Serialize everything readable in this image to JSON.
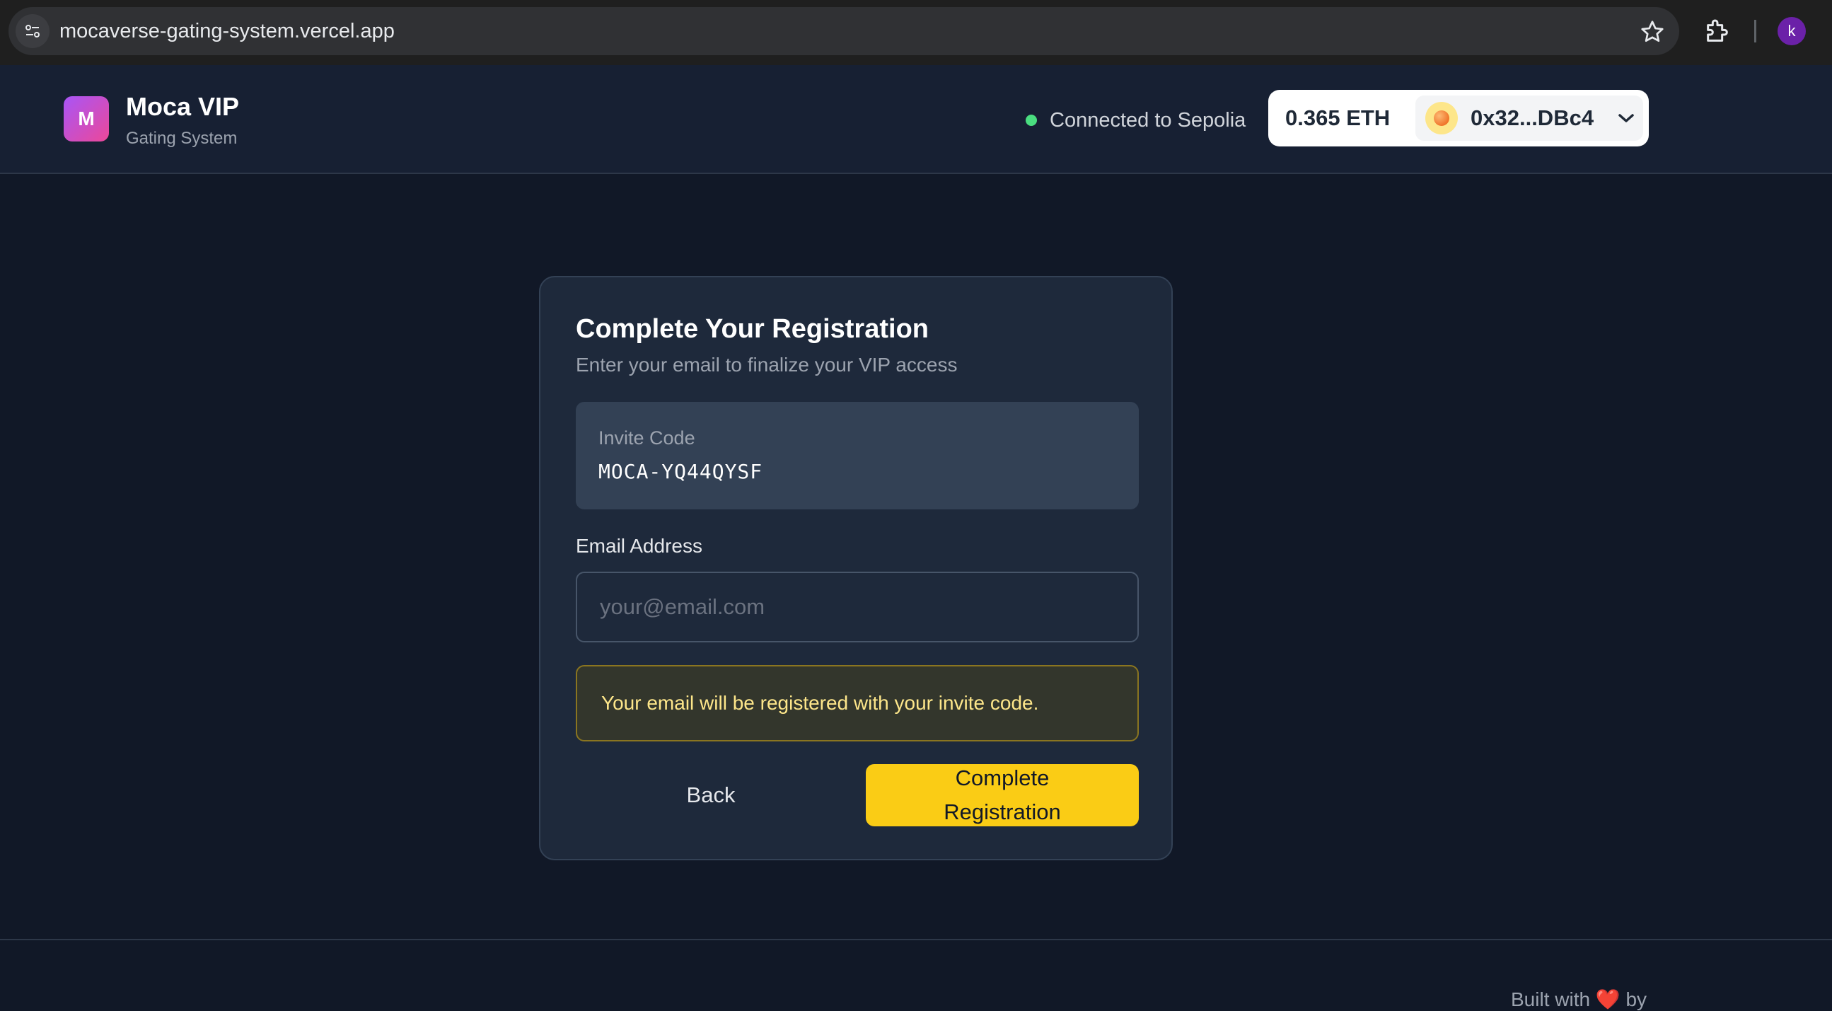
{
  "browser": {
    "url": "mocaverse-gating-system.vercel.app",
    "profile_initial": "k"
  },
  "header": {
    "logo_letter": "M",
    "title": "Moca VIP",
    "subtitle": "Gating System",
    "network_status": "Connected to Sepolia",
    "wallet": {
      "balance": "0.365 ETH",
      "address": "0x32...DBc4"
    }
  },
  "registration": {
    "title": "Complete Your Registration",
    "subtitle": "Enter your email to finalize your VIP access",
    "invite_label": "Invite Code",
    "invite_code": "MOCA-YQ44QYSF",
    "email_label": "Email Address",
    "email_placeholder": "your@email.com",
    "email_value": "",
    "notice": "Your email will be registered with your invite code.",
    "back_label": "Back",
    "complete_label": "Complete Registration"
  },
  "footer": {
    "built_with": "Built with",
    "heart": "❤️",
    "by": "by"
  },
  "colors": {
    "page_bg": "#111827",
    "card_bg": "#1e293b",
    "accent_yellow": "#facc15",
    "status_green": "#4ade80",
    "logo_gradient_start": "#a855f7",
    "logo_gradient_end": "#ec4899"
  }
}
